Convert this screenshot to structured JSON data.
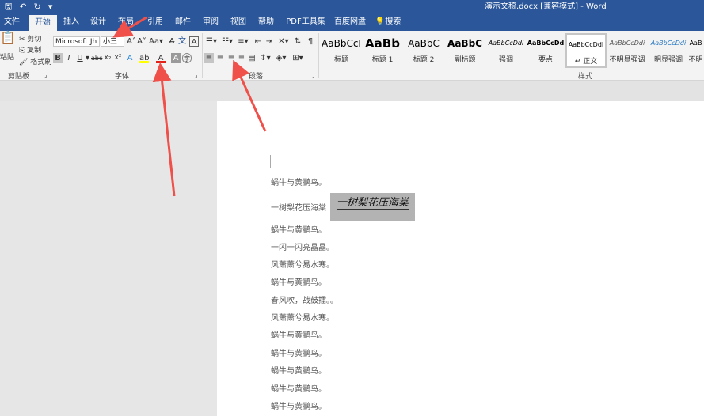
{
  "window": {
    "title": "演示文稿.docx [兼容模式] - Word"
  },
  "qat": {
    "save_icon": "save-icon",
    "undo_icon": "undo-icon",
    "redo_icon": "redo-icon",
    "more": "▾"
  },
  "tabs": [
    {
      "label": "文件"
    },
    {
      "label": "开始"
    },
    {
      "label": "插入"
    },
    {
      "label": "设计"
    },
    {
      "label": "布局"
    },
    {
      "label": "引用"
    },
    {
      "label": "邮件"
    },
    {
      "label": "审阅"
    },
    {
      "label": "视图"
    },
    {
      "label": "帮助"
    },
    {
      "label": "PDF工具集"
    },
    {
      "label": "百度网盘"
    },
    {
      "label": "搜索"
    }
  ],
  "clipboard": {
    "paste": "粘贴",
    "cut": "剪切",
    "copy": "复制",
    "format_painter": "格式刷",
    "label": "剪贴板"
  },
  "font": {
    "name": "Microsoft Jh",
    "size": "小三",
    "label": "字体"
  },
  "paragraph": {
    "label": "段落"
  },
  "styles": {
    "label": "样式",
    "items": [
      {
        "preview": "AaBbCcI",
        "name": "标题"
      },
      {
        "preview": "AaBb",
        "name": "标题 1"
      },
      {
        "preview": "AaBbC",
        "name": "标题 2"
      },
      {
        "preview": "AaBbC",
        "name": "副标题"
      },
      {
        "preview": "AaBbCcDdi",
        "name": "强调"
      },
      {
        "preview": "AaBbCcDd",
        "name": "要点"
      },
      {
        "preview": "AaBbCcDdI",
        "name": "↵ 正文"
      },
      {
        "preview": "AaBbCcDdi",
        "name": "不明显强调"
      },
      {
        "preview": "AaBbCcDdi",
        "name": "明显强调"
      },
      {
        "preview": "AaB",
        "name": "不明"
      }
    ]
  },
  "document": {
    "lines": [
      "蜗牛与黄鹂鸟。",
      "一树梨花压海棠",
      "蜗牛与黄鹂鸟。",
      "一闪一闪亮晶晶。",
      "风萧萧兮易水寒。",
      "蜗牛与黄鹂鸟。",
      "春风吹，战鼓擂。。",
      "风萧萧兮易水寒。",
      "蜗牛与黄鹂鸟。",
      "蜗牛与黄鹂鸟。",
      "蜗牛与黄鹂鸟。",
      "蜗牛与黄鹂鸟。",
      "蜗牛与黄鹂鸟。"
    ],
    "selected_text": "一树梨花压海棠"
  },
  "colors": {
    "titlebar": "#2b579a",
    "arrow": "#f0504a",
    "font_color_bar": "#e2231a",
    "highlight_bar": "#ffff00"
  }
}
